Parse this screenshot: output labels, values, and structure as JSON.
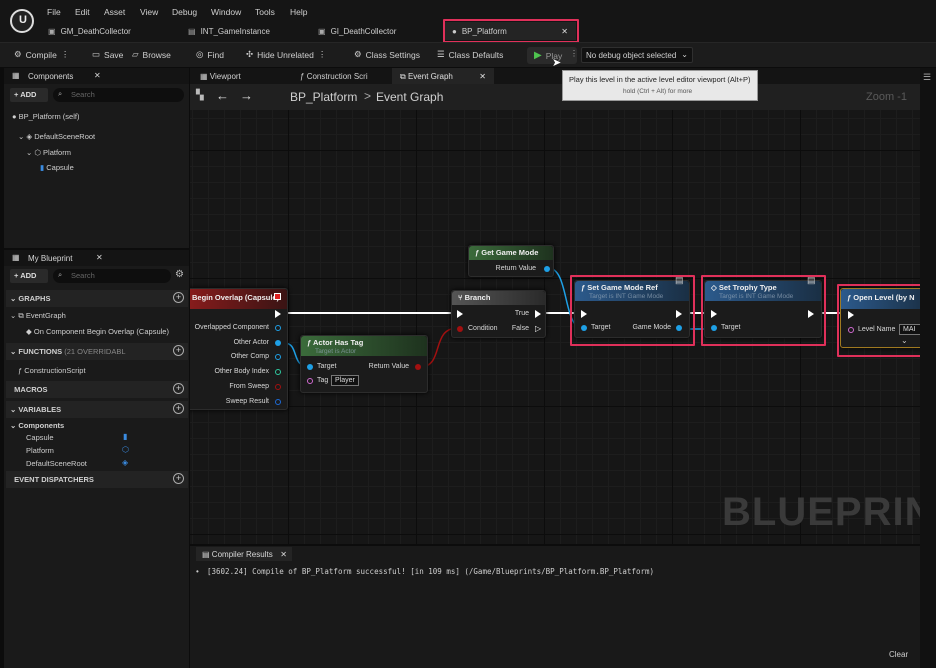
{
  "menu": [
    "File",
    "Edit",
    "Asset",
    "View",
    "Debug",
    "Window",
    "Tools",
    "Help"
  ],
  "doc_tabs": [
    "GM_DeathCollector",
    "INT_GameInstance",
    "GI_DeathCollector",
    "BP_Platform"
  ],
  "toolbar": {
    "compile": "Compile",
    "save": "Save",
    "browse": "Browse",
    "find": "Find",
    "hide_unrelated": "Hide Unrelated",
    "class_settings": "Class Settings",
    "class_defaults": "Class Defaults",
    "play": "Play",
    "debug_select": "No debug object selected"
  },
  "tooltip": {
    "main": "Play this level in the active level editor viewport (Alt+P)",
    "sub": "hold (Ctrl + Alt) for more"
  },
  "components_panel": {
    "title": "Components",
    "add": "ADD",
    "search_placeholder": "Search",
    "items": [
      "BP_Platform (self)",
      "DefaultSceneRoot",
      "Platform",
      "Capsule"
    ]
  },
  "my_blueprint": {
    "title": "My Blueprint",
    "add": "ADD",
    "search_placeholder": "Search",
    "sections": {
      "graphs": "GRAPHS",
      "functions": "FUNCTIONS",
      "functions_count": "(21 OVERRIDABL",
      "macros": "MACROS",
      "variables": "VARIABLES",
      "dispatchers": "EVENT DISPATCHERS"
    },
    "graph_items": [
      "EventGraph",
      "On Component Begin Overlap (Capsule)"
    ],
    "function_items": [
      "ConstructionScript"
    ],
    "components_label": "Components",
    "variables": [
      "Capsule",
      "Platform",
      "DefaultSceneRoot"
    ]
  },
  "graph_tabs": [
    "Viewport",
    "Construction Scri",
    "Event Graph"
  ],
  "breadcrumb": {
    "root": "BP_Platform",
    "sep": ">",
    "current": "Event Graph",
    "zoom": "Zoom -1"
  },
  "watermark": "BLUEPRINT",
  "nodes": {
    "overlap": {
      "title": "Begin Overlap (Capsule)",
      "pins": [
        "Overlapped Component",
        "Other Actor",
        "Other Comp",
        "Other Body Index",
        "From Sweep",
        "Sweep Result"
      ]
    },
    "get_game_mode": {
      "title": "Get Game Mode",
      "out": "Return Value"
    },
    "branch": {
      "title": "Branch",
      "condition": "Condition",
      "true_pin": "True",
      "false_pin": "False"
    },
    "actor_has_tag": {
      "title": "Actor Has Tag",
      "sub": "Target is Actor",
      "target": "Target",
      "tag": "Tag",
      "tag_value": "Player",
      "ret": "Return Value"
    },
    "set_game_mode_ref": {
      "title": "Set Game Mode Ref",
      "sub": "Target is INT Game Mode",
      "target": "Target",
      "game_mode": "Game Mode"
    },
    "set_trophy_type": {
      "title": "Set Trophy Type",
      "sub": "Target is INT Game Mode",
      "target": "Target"
    },
    "open_level": {
      "title": "Open Level (by N",
      "level_name": "Level Name",
      "level_value": "MAI"
    }
  },
  "compiler": {
    "tab": "Compiler Results",
    "message": "[3602.24] Compile of BP_Platform successful! [in 109 ms] (/Game/Blueprints/BP_Platform.BP_Platform)",
    "clear": "Clear"
  },
  "colors": {
    "highlight": "#e0305a",
    "exec_wire": "#ffffff",
    "object_pin": "#1ea0e6",
    "bool_pin": "#c41212",
    "string_pin": "#d06ad0"
  }
}
